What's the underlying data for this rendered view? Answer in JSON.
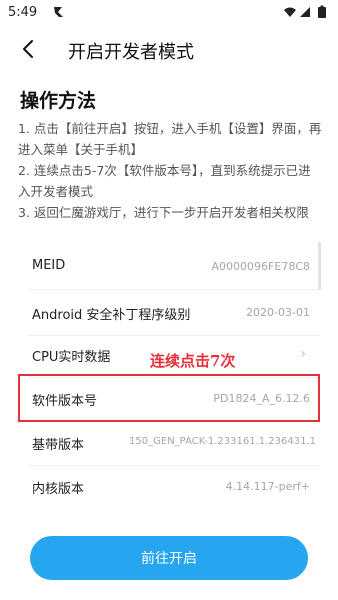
{
  "status_bar": {
    "time": "5:49"
  },
  "header": {
    "title": "开启开发者模式"
  },
  "section": {
    "title": "操作方法",
    "steps": [
      "1. 点击【前往开启】按钮，进入手机【设置】界面，再进入菜单【关于手机】",
      "2. 连续点击5-7次【软件版本号】，直到系统提示已进入开发者模式",
      "3. 返回仁魔游戏厅，进行下一步开启开发者相关权限"
    ]
  },
  "info_list": {
    "rows": [
      {
        "label": "MEID",
        "value": "A0000096FE78C8"
      },
      {
        "label": "Android 安全补丁程序级别",
        "value": "2020-03-01"
      },
      {
        "label": "CPU实时数据",
        "value": ""
      },
      {
        "label": "软件版本号",
        "value": "PD1824_A_6.12.6"
      },
      {
        "label": "基带版本",
        "value": "150_GEN_PACK-1.233161.1.236431.1"
      },
      {
        "label": "内核版本",
        "value": "4.14.117-perf+"
      }
    ]
  },
  "annotation": {
    "text": "连续点击7次"
  },
  "action_button": {
    "label": "前往开启"
  },
  "colors": {
    "accent": "#27a6f0",
    "highlight": "#e8303a"
  },
  "icons": {
    "back": "back-arrow-icon",
    "wifi": "wifi-icon",
    "signal": "signal-icon",
    "battery": "battery-icon",
    "chevron": "chevron-right-icon"
  }
}
